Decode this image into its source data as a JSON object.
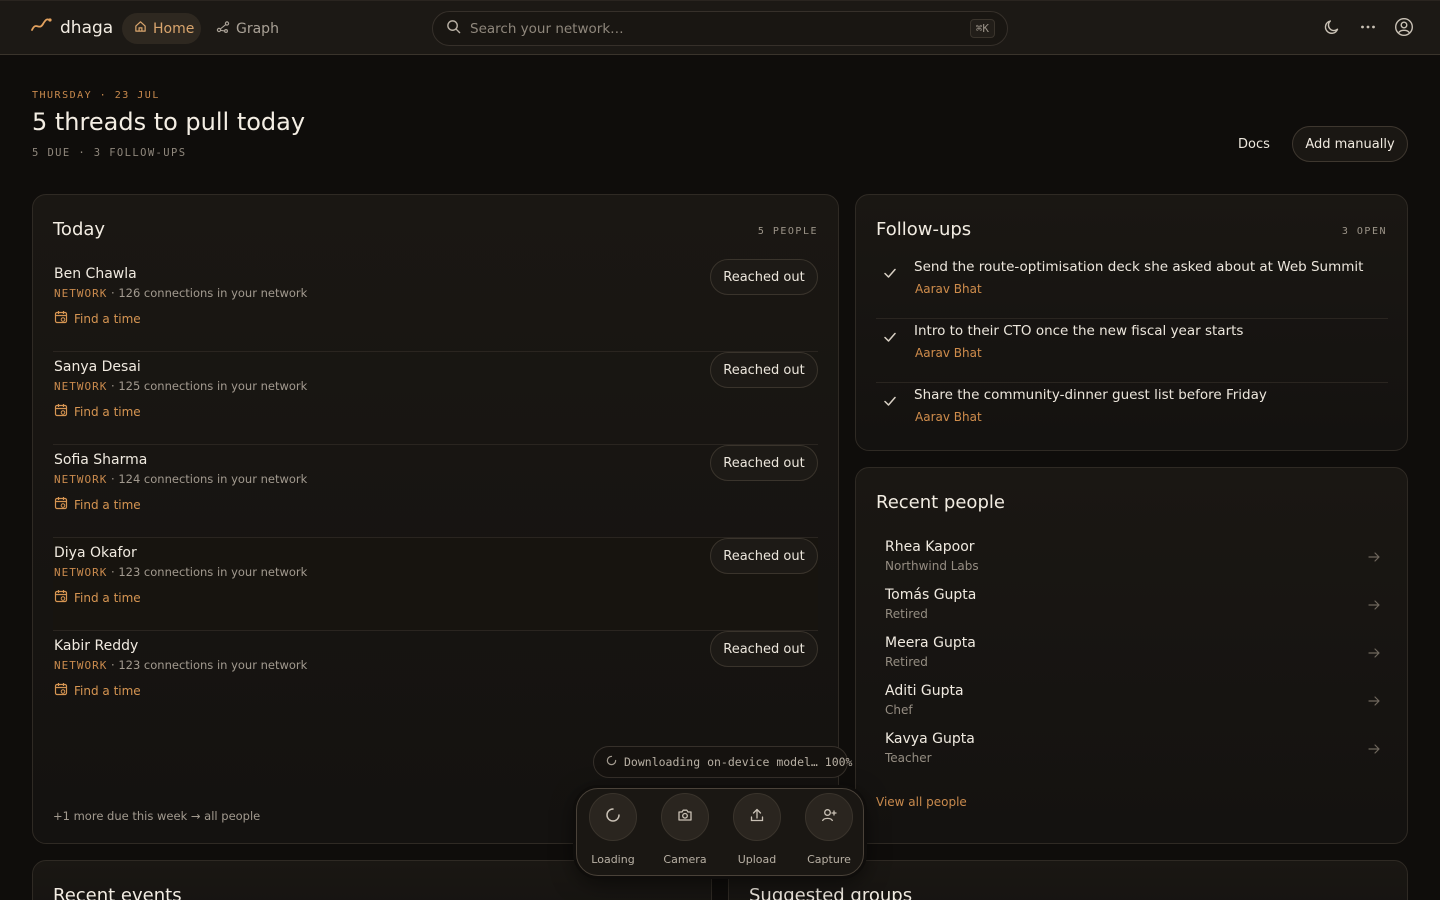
{
  "app": {
    "name": "dhaga"
  },
  "nav": {
    "home": "Home",
    "graph": "Graph"
  },
  "search": {
    "placeholder": "Search your network…",
    "shortcut": "⌘K"
  },
  "header": {
    "date": "THURSDAY · 23 JUL",
    "title": "5 threads to pull today",
    "summary": "5 DUE · 3 FOLLOW-UPS",
    "docs_label": "Docs",
    "add_label": "Add manually"
  },
  "today": {
    "title": "Today",
    "count": "5 PEOPLE",
    "tag": "NETWORK",
    "find_label": "Find a time",
    "action_label": "Reached out",
    "people": [
      {
        "name": "Ben Chawla",
        "meta": " · 126 connections in your network"
      },
      {
        "name": "Sanya Desai",
        "meta": " · 125 connections in your network"
      },
      {
        "name": "Sofia Sharma",
        "meta": " · 124 connections in your network"
      },
      {
        "name": "Diya Okafor",
        "meta": " · 123 connections in your network"
      },
      {
        "name": "Kabir Reddy",
        "meta": " · 123 connections in your network"
      }
    ],
    "more": "+1 more due this week → all people"
  },
  "followups": {
    "title": "Follow-ups",
    "count": "3 OPEN",
    "items": [
      {
        "text": "Send the route-optimisation deck she asked about at Web Summit",
        "who": "Aarav Bhat"
      },
      {
        "text": "Intro to their CTO once the new fiscal year starts",
        "who": "Aarav Bhat"
      },
      {
        "text": "Share the community-dinner guest list before Friday",
        "who": "Aarav Bhat"
      }
    ]
  },
  "recent_people": {
    "title": "Recent people",
    "items": [
      {
        "name": "Rhea Kapoor",
        "sub": "Northwind Labs"
      },
      {
        "name": "Tomás Gupta",
        "sub": "Retired"
      },
      {
        "name": "Meera Gupta",
        "sub": "Retired"
      },
      {
        "name": "Aditi Gupta",
        "sub": "Chef"
      },
      {
        "name": "Kavya Gupta",
        "sub": "Teacher"
      }
    ],
    "view_all": "View all people"
  },
  "toast": {
    "text": "Downloading on-device model… 100%"
  },
  "dock": {
    "loading": "Loading",
    "camera": "Camera",
    "upload": "Upload",
    "capture": "Capture"
  },
  "bottom": {
    "recent_events": "Recent events",
    "suggested_groups": "Suggested groups"
  },
  "colors": {
    "accent": "#c98a4d",
    "background": "#0f0d0b",
    "panel": "#1a1713"
  }
}
